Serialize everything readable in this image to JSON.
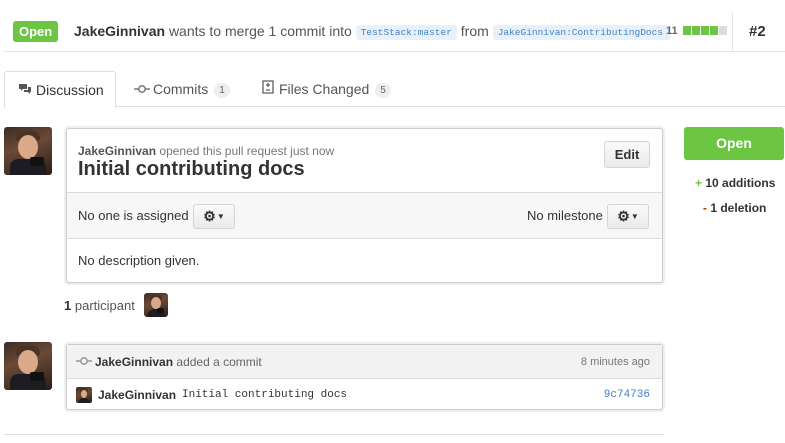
{
  "header": {
    "state": "Open",
    "author": "JakeGinnivan",
    "merge_phrase": "wants to merge 1 commit into",
    "base_ref": "TestStack:master",
    "from_word": "from",
    "head_ref": "JakeGinnivan:ContributingDocs",
    "diff_count": "11",
    "pr_number": "#2"
  },
  "tabs": [
    {
      "label": "Discussion",
      "icon": "comment-discussion-icon"
    },
    {
      "label": "Commits",
      "count": "1",
      "icon": "git-commit-icon"
    },
    {
      "label": "Files Changed",
      "count": "5",
      "icon": "diff-icon"
    }
  ],
  "discussion": {
    "author": "JakeGinnivan",
    "opened_text": "opened this pull request just now",
    "title": "Initial contributing docs",
    "edit_label": "Edit",
    "assignee_text": "No one is assigned",
    "milestone_text": "No milestone",
    "description": "No description given."
  },
  "sidebar": {
    "state_button": "Open",
    "additions": "10 additions",
    "deletions": "1 deletion",
    "plus": "+",
    "minus": "-"
  },
  "participants": {
    "count": "1",
    "label": "participant"
  },
  "commit_event": {
    "author": "JakeGinnivan",
    "action": "added a commit",
    "time": "8 minutes ago",
    "commit_author": "JakeGinnivan",
    "message": "Initial contributing docs",
    "sha": "9c74736"
  },
  "colors": {
    "open_green": "#6cc644",
    "link_blue": "#4183c4",
    "deletion_red": "#bd2c00"
  }
}
